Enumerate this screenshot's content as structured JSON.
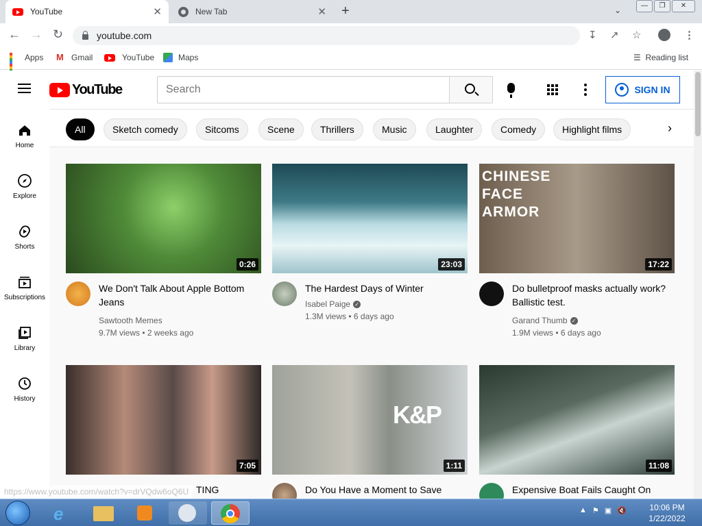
{
  "browser": {
    "tabs": [
      {
        "title": "YouTube",
        "active": true
      },
      {
        "title": "New Tab",
        "active": false
      }
    ],
    "new_tab_label": "+",
    "close_glyph": "✕",
    "url": "youtube.com",
    "bookmarks": [
      {
        "label": "Apps",
        "icon": "apps-grid-icon"
      },
      {
        "label": "Gmail",
        "icon": "gmail-icon"
      },
      {
        "label": "YouTube",
        "icon": "youtube-icon"
      },
      {
        "label": "Maps",
        "icon": "maps-icon"
      }
    ],
    "reading_list": "Reading list",
    "status_url": "https://www.youtube.com/watch?v=drVQdw6oQ6U"
  },
  "youtube": {
    "logo_text": "YouTube",
    "search_placeholder": "Search",
    "sign_in": "SIGN IN",
    "sidebar": [
      {
        "label": "Home",
        "icon": "home-icon"
      },
      {
        "label": "Explore",
        "icon": "compass-icon"
      },
      {
        "label": "Shorts",
        "icon": "shorts-icon"
      },
      {
        "label": "Subscriptions",
        "icon": "subscriptions-icon"
      },
      {
        "label": "Library",
        "icon": "library-icon"
      },
      {
        "label": "History",
        "icon": "history-icon"
      }
    ],
    "chips": [
      "All",
      "Sketch comedy",
      "Sitcoms",
      "Scene",
      "Thrillers",
      "Music",
      "Laughter",
      "Comedy",
      "Highlight films"
    ],
    "videos": [
      {
        "title": "We Don't Talk About Apple Bottom Jeans",
        "channel": "Sawtooth Memes",
        "verified": false,
        "views": "9.7M views",
        "age": "2 weeks ago",
        "duration": "0:26",
        "thumb_color": "#3c5a2a"
      },
      {
        "title": "The Hardest Days of Winter",
        "channel": "Isabel Paige",
        "verified": true,
        "views": "1.3M views",
        "age": "6 days ago",
        "duration": "23:03",
        "thumb_color": "#6b9aa8"
      },
      {
        "title": "Do bulletproof masks actually work? Ballistic test.",
        "channel": "Garand Thumb",
        "verified": true,
        "views": "1.9M views",
        "age": "6 days ago",
        "duration": "17:22",
        "thumb_color": "#8a7a68",
        "thumb_text": "CHINESE FACE ARMOR"
      },
      {
        "title": "TING",
        "channel": "",
        "verified": false,
        "views": "",
        "age": "",
        "duration": "7:05",
        "thumb_color": "#5a4a48"
      },
      {
        "title": "Do You Have a Moment to Save",
        "channel": "",
        "verified": false,
        "views": "",
        "age": "",
        "duration": "1:11",
        "thumb_color": "#a8a8a0",
        "thumb_text": "K&P"
      },
      {
        "title": "Expensive Boat Fails Caught On",
        "channel": "",
        "verified": false,
        "views": "",
        "age": "",
        "duration": "11:08",
        "thumb_color": "#3a4a40"
      }
    ],
    "meta_separator": "•"
  },
  "taskbar": {
    "time": "10:06 PM",
    "date": "1/22/2022"
  },
  "colors": {
    "youtube_red": "#ff0000",
    "signin_blue": "#065fd4",
    "chip_active": "#030303",
    "taskbar": "#4a78b0"
  }
}
